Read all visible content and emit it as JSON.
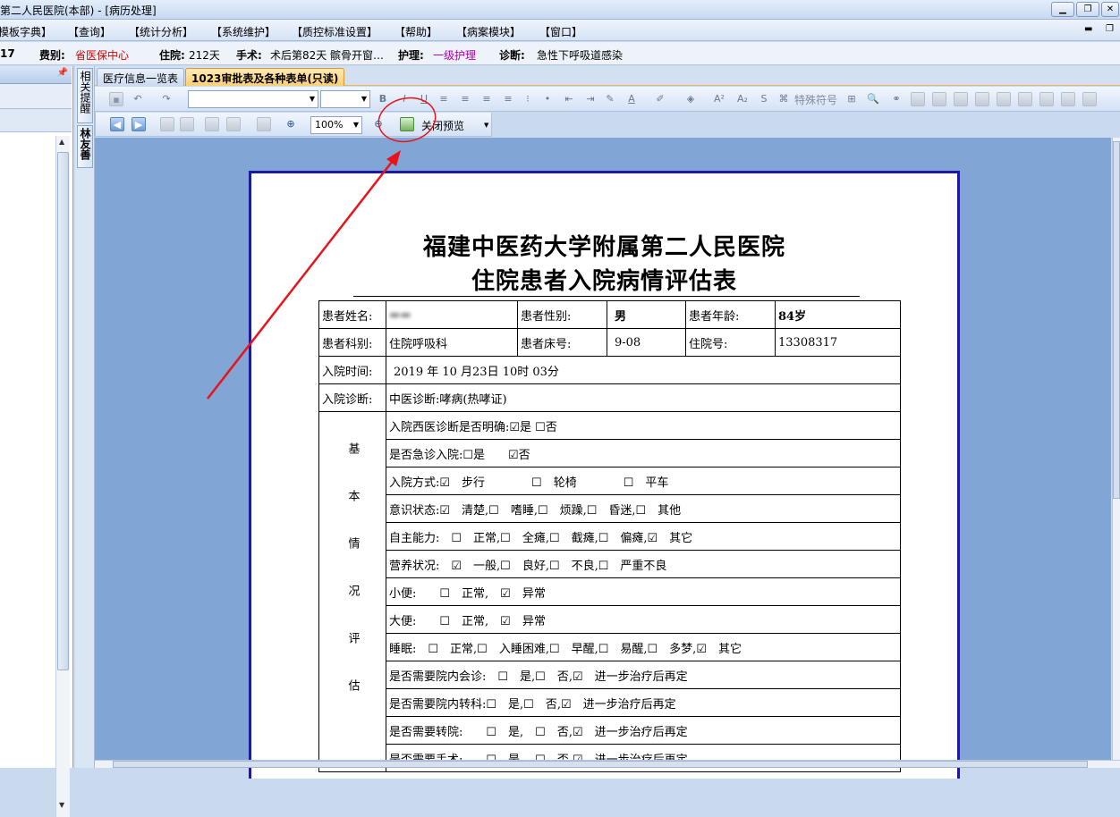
{
  "window": {
    "title": "第二人民医院(本部) - [病历处理]"
  },
  "menu": [
    "【模板字典】",
    "【查询】",
    "【统计分析】",
    "【系统维护】",
    "【质控标准设置】",
    "【帮助】",
    "【病案模块】",
    "【窗口】"
  ],
  "patient": {
    "bed_fragment": "17",
    "fee_label": "费别:",
    "fee_value": "省医保中心",
    "stay_label": "住院:",
    "stay_value": "212天",
    "surgery_label": "手术:",
    "surgery_value": "术后第82天",
    "surgery_name": "髌骨开窗…",
    "nursing_label": "护理:",
    "nursing_value": "一级护理",
    "diag_label": "诊断:",
    "diag_value": "急性下呼吸道感染"
  },
  "side_tabs": {
    "first": "相关提醒",
    "second": "林友善"
  },
  "doc_tabs": [
    {
      "label": "医疗信息一览表"
    },
    {
      "label": "1023审批表及各种表单(只读)"
    }
  ],
  "toolbar": {
    "special_chars": "特殊符号",
    "zoom": "100%",
    "close_preview": "关闭预览"
  },
  "colors": {
    "fee": "#d40000",
    "nursing": "#b000b0",
    "paper_border": "#1d1aa2",
    "annotation": "#e8141b"
  },
  "form": {
    "title1": "福建中医药大学附属第二人民医院",
    "title2": "住院患者入院病情评估表",
    "name_label": "患者姓名:",
    "name_value": "▬▬",
    "gender_label": "患者性别:",
    "gender_value": "男",
    "age_label": "患者年龄:",
    "age_value": "84岁",
    "dept_label": "患者科别:",
    "dept_value": "住院呼吸科",
    "bed_label": "患者床号:",
    "bed_value": "9-08",
    "inpatient_label": "住院号:",
    "inpatient_value": "13308317",
    "admit_time_label": "入院时间:",
    "admit_time_value": "2019 年 10 月23日 10时 03分",
    "admit_diag_label": "入院诊断:",
    "admit_diag_value": "中医诊断:哮病(热哮证)",
    "section_label": "基本情况评估",
    "rows": [
      "入院西医诊断是否明确:☑是 ☐否",
      "是否急诊入院:☐是　　☑否",
      "入院方式:☑　步行　　　　☐　轮椅　　　　☐　平车",
      "意识状态:☑　清楚,☐　嗜睡,☐　烦躁,☐　昏迷,☐　其他",
      "自主能力:　☐　正常,☐　全瘫,☐　截瘫,☐　偏瘫,☑　其它",
      "营养状况:　☑　一般,☐　良好,☐　不良,☐　严重不良",
      "小便:　　☐　正常,　☑　异常",
      "大便:　　☐　正常,　☑　异常",
      "睡眠:　☐　正常,☐　入睡困难,☐　早醒,☐　易醒,☐　多梦,☑　其它",
      "是否需要院内会诊:　☐　是,☐　否,☑　进一步治疗后再定",
      "是否需要院内转科:☐　是,☐　否,☑　进一步治疗后再定",
      "是否需要转院:　　☐　是,　☐　否,☑　进一步治疗后再定",
      "是否需要手术:　　☐　是,　☐　否,☑　进一步治疗后再定"
    ]
  }
}
